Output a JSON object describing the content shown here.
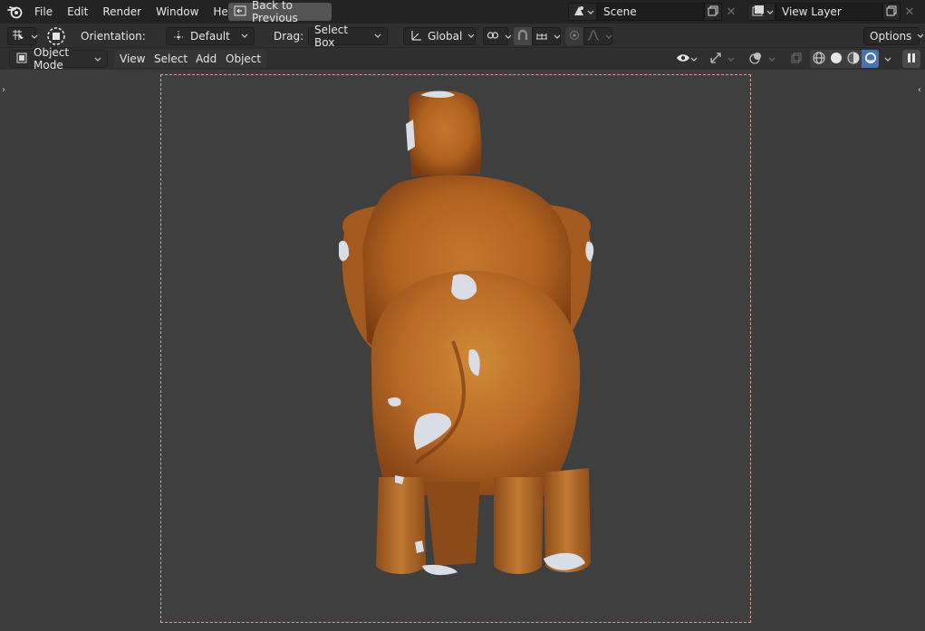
{
  "menu": {
    "file": "File",
    "edit": "Edit",
    "render": "Render",
    "window": "Window",
    "help": "Help",
    "back_to_previous": "Back to Previous"
  },
  "scene": {
    "name": "Scene"
  },
  "view_layer": {
    "name": "View Layer"
  },
  "tool_settings": {
    "orientation_label": "Orientation:",
    "orientation_value": "Default",
    "drag_label": "Drag:",
    "drag_value": "Select Box",
    "transform_orientation": "Global",
    "options": "Options"
  },
  "header": {
    "mode": "Object Mode",
    "view": "View",
    "select": "Select",
    "add": "Add",
    "object": "Object"
  },
  "colors": {
    "accent": "#4772b3",
    "camera_frame": "#e0a090",
    "viewport_bg": "#3d3d3d"
  }
}
